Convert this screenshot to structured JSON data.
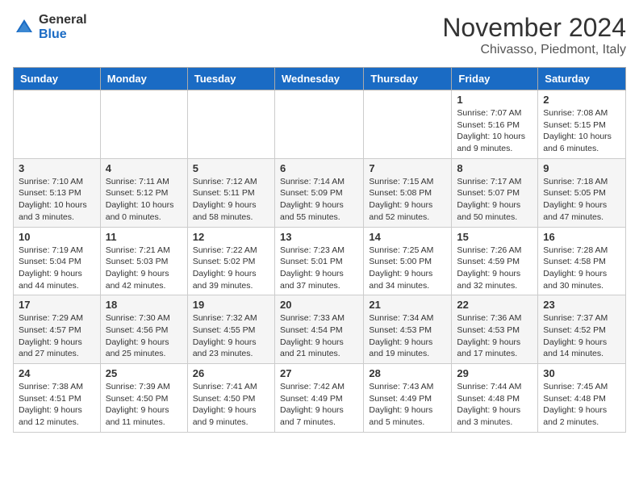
{
  "header": {
    "logo_general": "General",
    "logo_blue": "Blue",
    "month": "November 2024",
    "location": "Chivasso, Piedmont, Italy"
  },
  "weekdays": [
    "Sunday",
    "Monday",
    "Tuesday",
    "Wednesday",
    "Thursday",
    "Friday",
    "Saturday"
  ],
  "rows": [
    [
      {
        "day": "",
        "info": ""
      },
      {
        "day": "",
        "info": ""
      },
      {
        "day": "",
        "info": ""
      },
      {
        "day": "",
        "info": ""
      },
      {
        "day": "",
        "info": ""
      },
      {
        "day": "1",
        "info": "Sunrise: 7:07 AM\nSunset: 5:16 PM\nDaylight: 10 hours and 9 minutes."
      },
      {
        "day": "2",
        "info": "Sunrise: 7:08 AM\nSunset: 5:15 PM\nDaylight: 10 hours and 6 minutes."
      }
    ],
    [
      {
        "day": "3",
        "info": "Sunrise: 7:10 AM\nSunset: 5:13 PM\nDaylight: 10 hours and 3 minutes."
      },
      {
        "day": "4",
        "info": "Sunrise: 7:11 AM\nSunset: 5:12 PM\nDaylight: 10 hours and 0 minutes."
      },
      {
        "day": "5",
        "info": "Sunrise: 7:12 AM\nSunset: 5:11 PM\nDaylight: 9 hours and 58 minutes."
      },
      {
        "day": "6",
        "info": "Sunrise: 7:14 AM\nSunset: 5:09 PM\nDaylight: 9 hours and 55 minutes."
      },
      {
        "day": "7",
        "info": "Sunrise: 7:15 AM\nSunset: 5:08 PM\nDaylight: 9 hours and 52 minutes."
      },
      {
        "day": "8",
        "info": "Sunrise: 7:17 AM\nSunset: 5:07 PM\nDaylight: 9 hours and 50 minutes."
      },
      {
        "day": "9",
        "info": "Sunrise: 7:18 AM\nSunset: 5:05 PM\nDaylight: 9 hours and 47 minutes."
      }
    ],
    [
      {
        "day": "10",
        "info": "Sunrise: 7:19 AM\nSunset: 5:04 PM\nDaylight: 9 hours and 44 minutes."
      },
      {
        "day": "11",
        "info": "Sunrise: 7:21 AM\nSunset: 5:03 PM\nDaylight: 9 hours and 42 minutes."
      },
      {
        "day": "12",
        "info": "Sunrise: 7:22 AM\nSunset: 5:02 PM\nDaylight: 9 hours and 39 minutes."
      },
      {
        "day": "13",
        "info": "Sunrise: 7:23 AM\nSunset: 5:01 PM\nDaylight: 9 hours and 37 minutes."
      },
      {
        "day": "14",
        "info": "Sunrise: 7:25 AM\nSunset: 5:00 PM\nDaylight: 9 hours and 34 minutes."
      },
      {
        "day": "15",
        "info": "Sunrise: 7:26 AM\nSunset: 4:59 PM\nDaylight: 9 hours and 32 minutes."
      },
      {
        "day": "16",
        "info": "Sunrise: 7:28 AM\nSunset: 4:58 PM\nDaylight: 9 hours and 30 minutes."
      }
    ],
    [
      {
        "day": "17",
        "info": "Sunrise: 7:29 AM\nSunset: 4:57 PM\nDaylight: 9 hours and 27 minutes."
      },
      {
        "day": "18",
        "info": "Sunrise: 7:30 AM\nSunset: 4:56 PM\nDaylight: 9 hours and 25 minutes."
      },
      {
        "day": "19",
        "info": "Sunrise: 7:32 AM\nSunset: 4:55 PM\nDaylight: 9 hours and 23 minutes."
      },
      {
        "day": "20",
        "info": "Sunrise: 7:33 AM\nSunset: 4:54 PM\nDaylight: 9 hours and 21 minutes."
      },
      {
        "day": "21",
        "info": "Sunrise: 7:34 AM\nSunset: 4:53 PM\nDaylight: 9 hours and 19 minutes."
      },
      {
        "day": "22",
        "info": "Sunrise: 7:36 AM\nSunset: 4:53 PM\nDaylight: 9 hours and 17 minutes."
      },
      {
        "day": "23",
        "info": "Sunrise: 7:37 AM\nSunset: 4:52 PM\nDaylight: 9 hours and 14 minutes."
      }
    ],
    [
      {
        "day": "24",
        "info": "Sunrise: 7:38 AM\nSunset: 4:51 PM\nDaylight: 9 hours and 12 minutes."
      },
      {
        "day": "25",
        "info": "Sunrise: 7:39 AM\nSunset: 4:50 PM\nDaylight: 9 hours and 11 minutes."
      },
      {
        "day": "26",
        "info": "Sunrise: 7:41 AM\nSunset: 4:50 PM\nDaylight: 9 hours and 9 minutes."
      },
      {
        "day": "27",
        "info": "Sunrise: 7:42 AM\nSunset: 4:49 PM\nDaylight: 9 hours and 7 minutes."
      },
      {
        "day": "28",
        "info": "Sunrise: 7:43 AM\nSunset: 4:49 PM\nDaylight: 9 hours and 5 minutes."
      },
      {
        "day": "29",
        "info": "Sunrise: 7:44 AM\nSunset: 4:48 PM\nDaylight: 9 hours and 3 minutes."
      },
      {
        "day": "30",
        "info": "Sunrise: 7:45 AM\nSunset: 4:48 PM\nDaylight: 9 hours and 2 minutes."
      }
    ]
  ]
}
